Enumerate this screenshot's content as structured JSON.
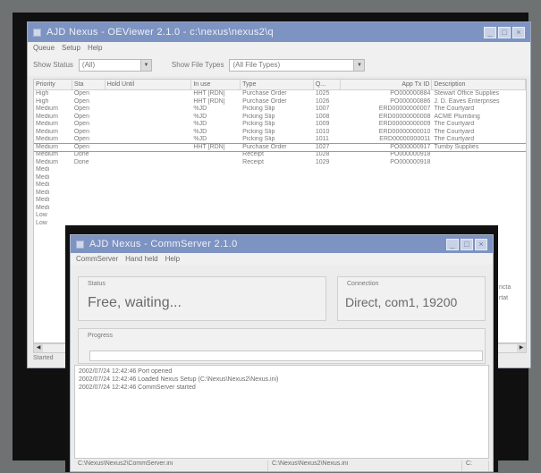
{
  "win1": {
    "title": "AJD Nexus - OEViewer 2.1.0 - c:\\nexus\\nexus2\\q",
    "menu": [
      "Queue",
      "Setup",
      "Help"
    ],
    "filter": {
      "status_label": "Show Status",
      "status_value": "(All)",
      "filetypes_label": "Show File Types",
      "filetypes_value": "(All File Types)"
    },
    "columns": [
      "Priority",
      "Sta",
      "Hold Until",
      "In use",
      "Type",
      "Q...",
      "App Tx ID",
      "Description"
    ],
    "rows": [
      [
        "High",
        "Open",
        "",
        "HHT [RDN]",
        "Purchase Order",
        "1025",
        "PO000000884",
        "Stewart Office Supplies"
      ],
      [
        "High",
        "Open",
        "",
        "HHT [RDN]",
        "Purchase Order",
        "1026",
        "PO000000886",
        "J. D. Eaves Enterprises"
      ],
      [
        "Medium",
        "Open",
        "",
        "%JD",
        "Picking Slip",
        "1007",
        "ERD00000000007",
        "The Courtyard"
      ],
      [
        "Medium",
        "Open",
        "",
        "%JD",
        "Picking Slip",
        "1008",
        "ERD00000000008",
        "ACME Plumbing"
      ],
      [
        "Medium",
        "Open",
        "",
        "%JD",
        "Picking Slip",
        "1009",
        "ERD00000000009",
        "The Courtyard"
      ],
      [
        "Medium",
        "Open",
        "",
        "%JD",
        "Picking Slip",
        "1010",
        "ERD00000000010",
        "The Courtyard"
      ],
      [
        "Medium",
        "Open",
        "",
        "%JD",
        "Picking Slip",
        "1011",
        "ERD00000000011",
        "The Courtyard"
      ],
      [
        "Medium",
        "Open",
        "",
        "HHT [RDN]",
        "Purchase Order",
        "1027",
        "PO000000917",
        "Tumby Supplies"
      ],
      [
        "Medium",
        "Done",
        "",
        "",
        "Receipt",
        "1028",
        "PO000000918",
        ""
      ],
      [
        "Medium",
        "Done",
        "",
        "",
        "Receipt",
        "1029",
        "PO000000918",
        ""
      ],
      [
        "Medi",
        "",
        "",
        "",
        "",
        "",
        "",
        ""
      ],
      [
        "Medi",
        "",
        "",
        "",
        "",
        "",
        "",
        ""
      ],
      [
        "Medi",
        "",
        "",
        "",
        "",
        "",
        "",
        ""
      ],
      [
        "Medi",
        "",
        "",
        "",
        "",
        "",
        "",
        ""
      ],
      [
        "Medi",
        "",
        "",
        "",
        "",
        "",
        "",
        ""
      ],
      [
        "Medi",
        "",
        "",
        "",
        "",
        "",
        "",
        ""
      ],
      [
        "Low",
        "",
        "",
        "",
        "",
        "",
        "",
        ""
      ],
      [
        "Low",
        "",
        "",
        "",
        "",
        "",
        "",
        ""
      ]
    ],
    "status": "Started",
    "right_trunc": [
      "ncta",
      "rtat"
    ]
  },
  "win2": {
    "title": "AJD Nexus - CommServer 2.1.0",
    "menu": [
      "CommServer",
      "Hand held",
      "Help"
    ],
    "status_label": "Status",
    "status_value": "Free, waiting...",
    "connection_label": "Connection",
    "connection_value": "Direct, com1, 19200",
    "progress_label": "Progress",
    "progress_fraction": 0,
    "log": [
      "2002/07/24 12:42:46 Port opened",
      "2002/07/24 12:42:46 Loaded Nexus Setup (C:\\Nexus\\Nexus2\\Nexus.ini)",
      "2002/07/24 12:42:46 CommServer started"
    ],
    "statusbar": [
      "C:\\Nexus\\Nexus2\\CommServer.ini",
      "C:\\Nexus\\Nexus2\\Nexus.ini",
      "C:"
    ]
  }
}
